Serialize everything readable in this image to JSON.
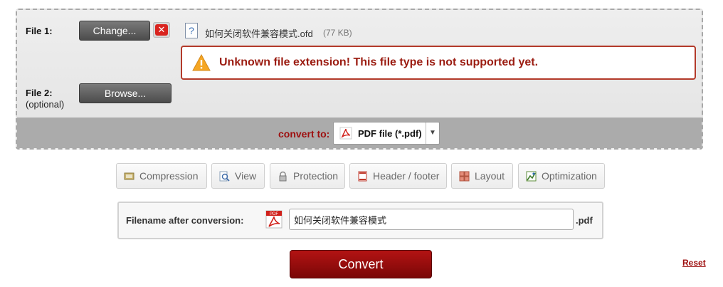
{
  "file1": {
    "label": "File 1:",
    "change_button": "Change...",
    "remove_icon": "close-icon",
    "file_icon": "unknown-file-icon",
    "file_name": "如何关闭软件兼容模式.ofd",
    "file_size": "(77 KB)"
  },
  "error": {
    "icon": "warning-icon",
    "message": "Unknown file extension! This file type is not supported yet."
  },
  "file2": {
    "label": "File 2:",
    "optional": "(optional)",
    "browse_button": "Browse..."
  },
  "convert_to": {
    "label": "convert to:",
    "selected": "PDF file (*.pdf)",
    "icon": "pdf-icon"
  },
  "tabs": [
    {
      "label": "Compression",
      "icon": "compression-icon"
    },
    {
      "label": "View",
      "icon": "view-icon"
    },
    {
      "label": "Protection",
      "icon": "lock-icon"
    },
    {
      "label": "Header / footer",
      "icon": "header-footer-icon"
    },
    {
      "label": "Layout",
      "icon": "layout-icon"
    },
    {
      "label": "Optimization",
      "icon": "optimization-icon"
    }
  ],
  "filename": {
    "label": "Filename after conversion:",
    "value": "如何关闭软件兼容模式",
    "extension": ".pdf",
    "icon": "pdf-icon"
  },
  "convert_button": "Convert",
  "reset_link": "Reset",
  "colors": {
    "accent": "#9e0f0f",
    "error_border": "#b33a2a",
    "button_dark": "#5a5a5a",
    "convert_button": "#a01010"
  }
}
